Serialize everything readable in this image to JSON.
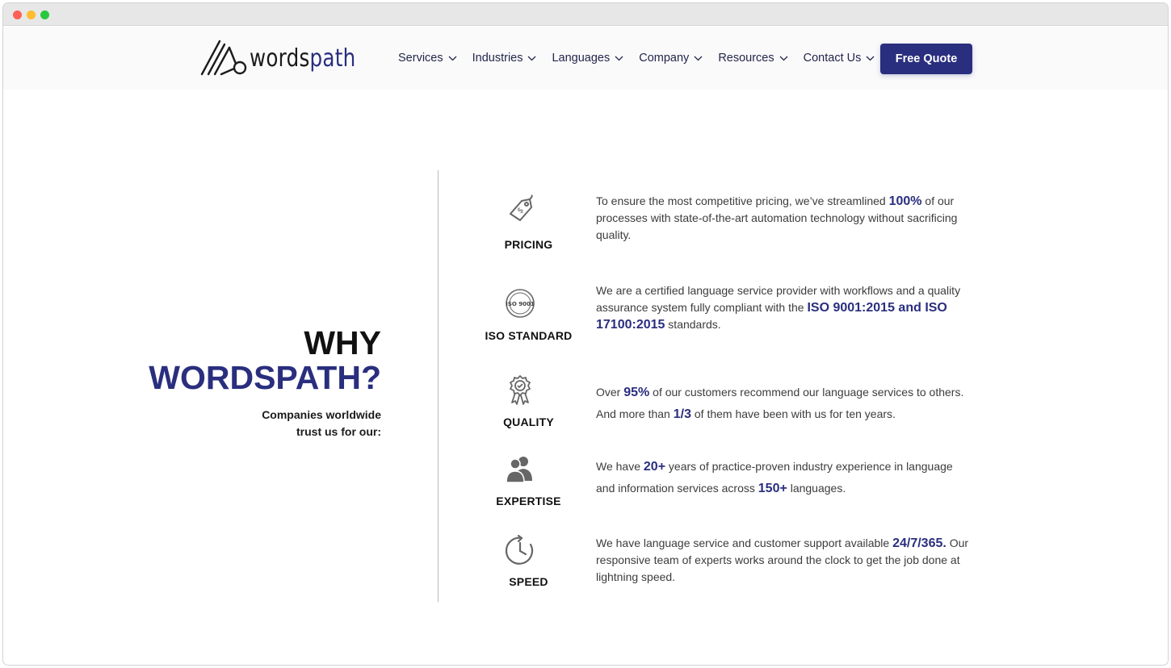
{
  "brand": {
    "logo_part1": "words",
    "logo_part2": "path",
    "accent_color": "#2a2e7e"
  },
  "nav": {
    "items": [
      {
        "label": "Services"
      },
      {
        "label": "Industries"
      },
      {
        "label": "Languages"
      },
      {
        "label": "Company"
      },
      {
        "label": "Resources"
      },
      {
        "label": "Contact Us"
      }
    ],
    "cta_label": "Free Quote"
  },
  "why": {
    "title_line1": "WHY",
    "title_line2": "WORDSPATH?",
    "subtitle_line1": "Companies worldwide",
    "subtitle_line2": "trust us for our:"
  },
  "features": [
    {
      "label": "PRICING",
      "icon": "price-tag-icon",
      "t1": "To ensure the most competitive pricing, we’ve streamlined ",
      "h1": "100%",
      "t2": " of our processes with state-of-the-art automation technology without sacrificing quality."
    },
    {
      "label": "ISO STANDARD",
      "icon": "iso-certified-icon",
      "iso_badge": "ISO 9001",
      "t1": "We are a certified language service provider with workflows and a quality assurance system fully compliant with the ",
      "h1": "ISO 9001:2015 and ISO 17100:2015",
      "t2": " standards."
    },
    {
      "label": "QUALITY",
      "icon": "award-ribbon-icon",
      "t1": "Over ",
      "h1": "95%",
      "t2": " of our customers recommend our language services to others. And more than ",
      "h2": "1/3",
      "t3": " of them have been with us for ten years."
    },
    {
      "label": "EXPERTISE",
      "icon": "people-icon",
      "t1": "We have ",
      "h1": "20+",
      "t2": " years of practice-proven industry experience in language and information services across ",
      "h2": "150+",
      "t3": " languages."
    },
    {
      "label": "SPEED",
      "icon": "clock-icon",
      "t1": "We have language service and customer support available ",
      "h1": "24/7/365.",
      "t2": " Our responsive team of experts works around the clock to get the job done at lightning speed."
    }
  ]
}
